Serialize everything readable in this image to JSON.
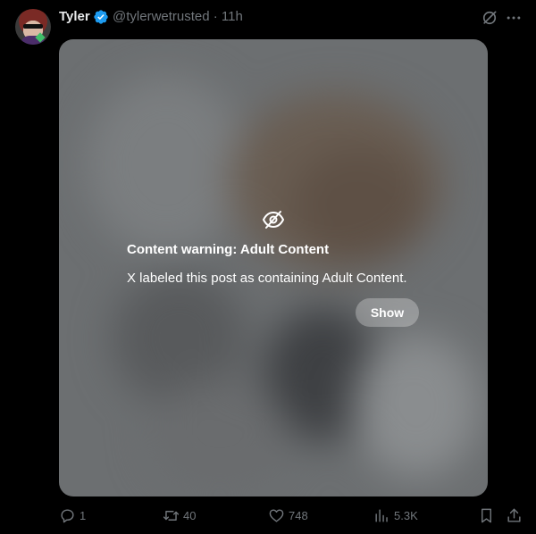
{
  "author": {
    "name": "Tyler",
    "handle_time": "@tylerwetrusted · 11h",
    "verified_color": "#1d9bf0"
  },
  "header_icons": [
    "grok-icon",
    "more-icon"
  ],
  "media": {
    "warning_icon": "eye-slash-icon",
    "warning_title": "Content warning: Adult Content",
    "warning_text": "X labeled this post as containing Adult Content.",
    "show_label": "Show"
  },
  "actions": {
    "reply_count": "1",
    "repost_count": "40",
    "like_count": "748",
    "view_count": "5.3K"
  },
  "colors": {
    "background": "#000000",
    "text": "#e7e9ea",
    "muted": "#71767b"
  }
}
